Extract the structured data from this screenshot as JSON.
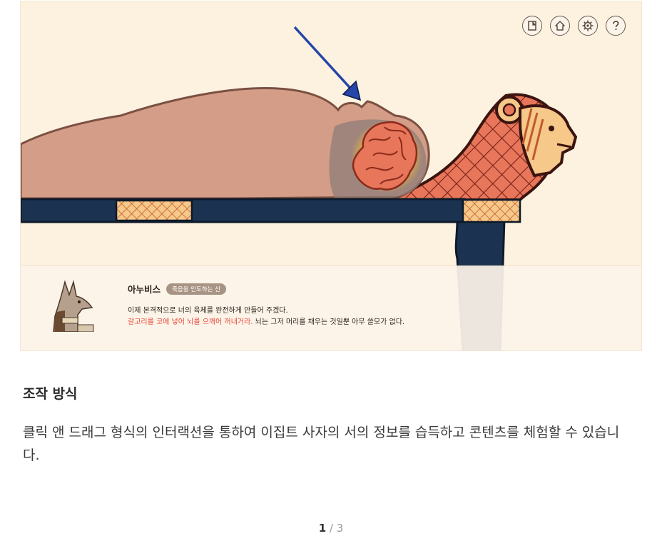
{
  "toolbar": {
    "buttons": [
      {
        "name": "bookmark",
        "icon": "book-page-icon"
      },
      {
        "name": "home",
        "icon": "home-icon"
      },
      {
        "name": "settings",
        "icon": "gear-icon"
      },
      {
        "name": "help",
        "icon": "question-icon"
      }
    ]
  },
  "dialog": {
    "speaker": "아누비스",
    "role_badge": "죽음을 인도하는 신",
    "line1": "이제 본격적으로 너의 육체를 완전하게 만들어 주겠다.",
    "line2_highlight": "갈고리를 코에 넣어 뇌를 으깨어 꺼내거라.",
    "line2_rest": " 뇌는 그저 머리를 채우는 것일뿐 아무 쓸모가 없다."
  },
  "section": {
    "title": "조작 방식",
    "description": "클릭 앤 드래그 형식의 인터랙션을 통하여 이집트 사자의 서의 정보를 습득하고 콘텐츠를 체험할 수 있습니다."
  },
  "pager": {
    "current": "1",
    "separator": " / ",
    "total": "3"
  },
  "colors": {
    "background": "#fdf2e0",
    "body": "#d49d88",
    "bed": "#1b3350",
    "lion": "#e7765a",
    "highlight_text": "#e8483c",
    "arrow": "#2645a8"
  }
}
